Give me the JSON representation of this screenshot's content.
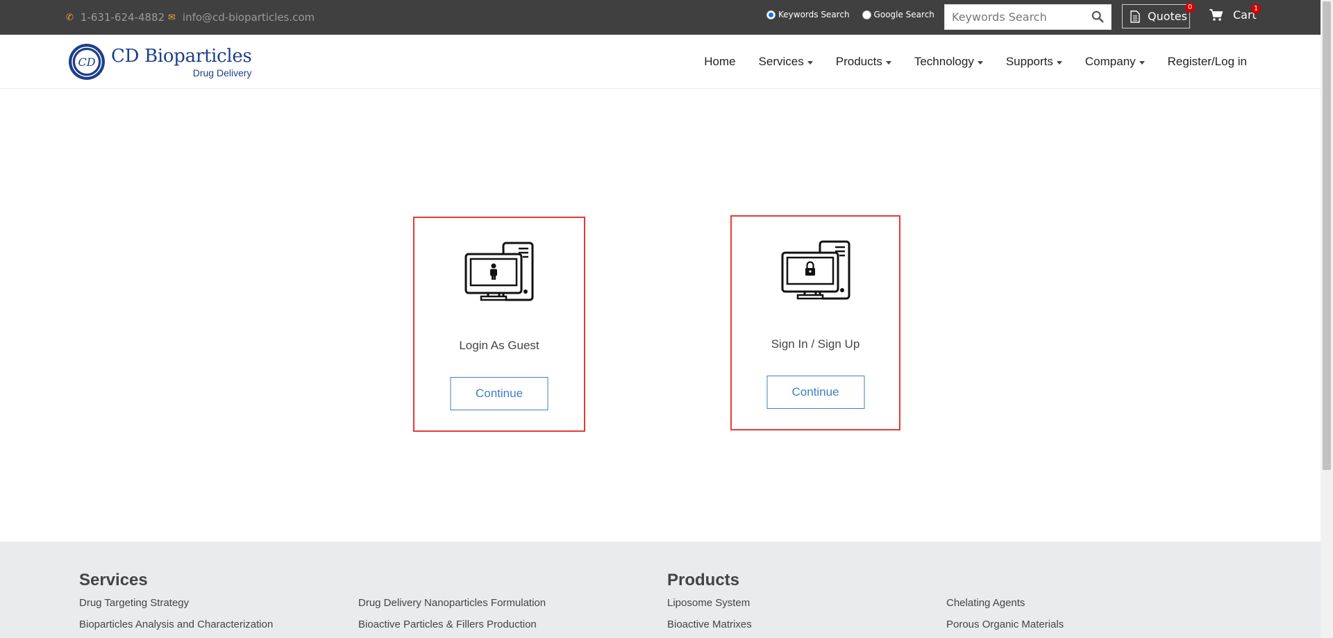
{
  "topbar": {
    "phone": "1-631-624-4882",
    "email": "info@cd-bioparticles.com",
    "search_options": [
      {
        "label": "Keywords Search",
        "checked": true
      },
      {
        "label": "Google Search",
        "checked": false
      }
    ],
    "search_placeholder": "Keywords Search",
    "quotes_label": "Quotes",
    "quotes_count": "0",
    "cart_label": "Cart",
    "cart_count": "1"
  },
  "logo": {
    "monogram": "CD",
    "name": "CD Bioparticles",
    "subtitle": "Drug Delivery"
  },
  "nav": {
    "items": [
      {
        "label": "Home",
        "dropdown": false
      },
      {
        "label": "Services",
        "dropdown": true
      },
      {
        "label": "Products",
        "dropdown": true
      },
      {
        "label": "Technology",
        "dropdown": true
      },
      {
        "label": "Supports",
        "dropdown": true
      },
      {
        "label": "Company",
        "dropdown": true
      },
      {
        "label": "Register/Log in",
        "dropdown": false
      }
    ]
  },
  "cards": {
    "guest": {
      "label": "Login As Guest",
      "button": "Continue"
    },
    "signin": {
      "label": "Sign In / Sign Up",
      "button": "Continue"
    }
  },
  "footer": {
    "services_title": "Services",
    "services_col1": [
      "Drug Targeting Strategy",
      "Bioparticles Analysis and Characterization"
    ],
    "services_col2": [
      "Drug Delivery Nanoparticles Formulation",
      "Bioactive Particles & Fillers Production"
    ],
    "products_title": "Products",
    "products_col1": [
      "Liposome System",
      "Bioactive Matrixes"
    ],
    "products_col2": [
      "Chelating Agents",
      "Porous Organic Materials"
    ]
  },
  "colors": {
    "topbar_bg": "#404040",
    "accent_blue": "#3f7ec4",
    "card_border": "#e53935",
    "badge_red": "#d20000",
    "brand_blue": "#1d3f8c",
    "footer_bg": "#e9ebed"
  }
}
